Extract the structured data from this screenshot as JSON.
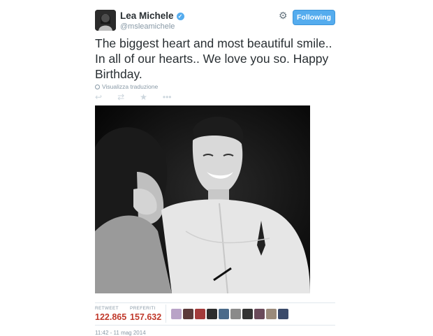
{
  "user": {
    "name": "Lea Michele",
    "handle": "@msleamichele"
  },
  "follow_label": "Following",
  "tweet_text": "The biggest heart and most beautiful smile.. In all of our hearts.. We love you so. Happy Birthday.",
  "translate_label": "Visualizza traduzione",
  "actions": [
    "reply-icon",
    "retweet-icon",
    "favorite-icon",
    "more-icon"
  ],
  "stats": {
    "retweet_label": "RETWEET",
    "retweet_count": "122.865",
    "fav_label": "PREFERITI",
    "fav_count": "157.632"
  },
  "timestamp": "11:42 - 11 mag 2014",
  "colors": {
    "accent": "#55acee",
    "count": "#c0392b"
  }
}
